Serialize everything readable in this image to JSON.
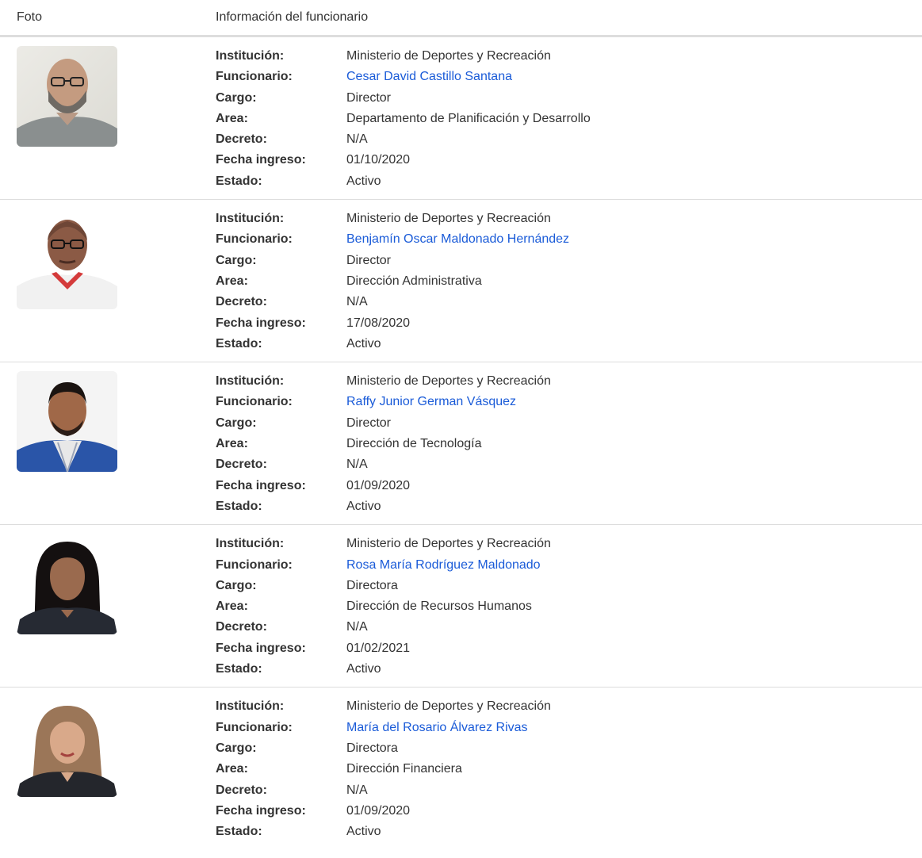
{
  "table": {
    "header_photo": "Foto",
    "header_info": "Información del funcionario"
  },
  "labels": {
    "institucion": "Institución:",
    "funcionario": "Funcionario:",
    "cargo": "Cargo:",
    "area": "Area:",
    "decreto": "Decreto:",
    "fecha_ingreso": "Fecha ingreso:",
    "estado": "Estado:"
  },
  "officials": [
    {
      "institucion": "Ministerio de Deportes y Recreación",
      "funcionario": "Cesar David Castillo Santana",
      "cargo": "Director",
      "area": "Departamento de Planificación y Desarrollo",
      "decreto": "N/A",
      "fecha_ingreso": "01/10/2020",
      "estado": "Activo"
    },
    {
      "institucion": "Ministerio de Deportes y Recreación",
      "funcionario": "Benjamín Oscar Maldonado Hernández",
      "cargo": "Director",
      "area": "Dirección Administrativa",
      "decreto": "N/A",
      "fecha_ingreso": "17/08/2020",
      "estado": "Activo"
    },
    {
      "institucion": "Ministerio de Deportes y Recreación",
      "funcionario": "Raffy Junior German Vásquez",
      "cargo": "Director",
      "area": "Dirección de Tecnología",
      "decreto": "N/A",
      "fecha_ingreso": "01/09/2020",
      "estado": "Activo"
    },
    {
      "institucion": "Ministerio de Deportes y Recreación",
      "funcionario": "Rosa María Rodríguez Maldonado",
      "cargo": "Directora",
      "area": "Dirección de Recursos Humanos",
      "decreto": "N/A",
      "fecha_ingreso": "01/02/2021",
      "estado": "Activo"
    },
    {
      "institucion": "Ministerio de Deportes y Recreación",
      "funcionario": "María del Rosario Álvarez Rivas",
      "cargo": "Directora",
      "area": "Dirección Financiera",
      "decreto": "N/A",
      "fecha_ingreso": "01/09/2020",
      "estado": "Activo"
    }
  ],
  "colors": {
    "link": "#1a5bd8",
    "text": "#333333",
    "divider": "#dddddd"
  }
}
